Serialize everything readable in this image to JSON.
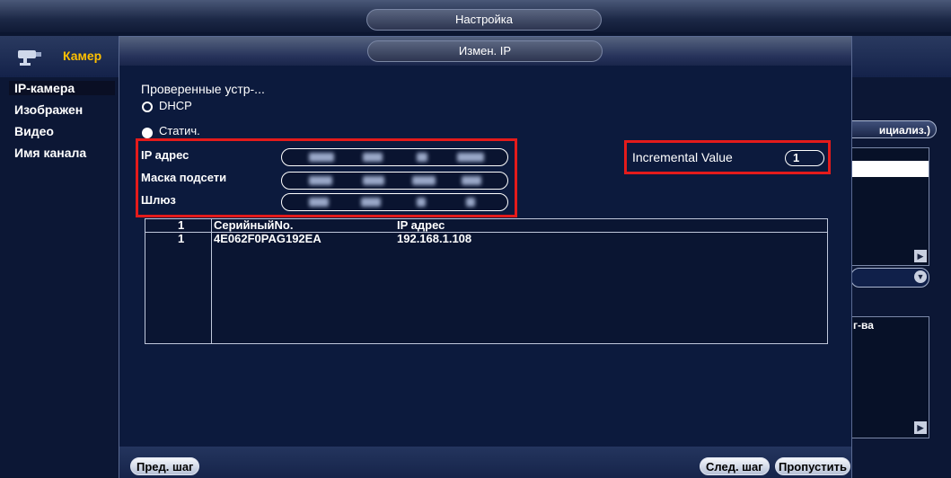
{
  "background": {
    "window_title": "Настройка",
    "header_title": "Камер",
    "sidebar": {
      "items": [
        {
          "label": "IP-камера",
          "active": true
        },
        {
          "label": "Изображен"
        },
        {
          "label": "Видео"
        },
        {
          "label": "Имя канала"
        }
      ]
    },
    "right_button_label": "ициализ.)",
    "right_box_label": "г-ва"
  },
  "dialog": {
    "title": "Измен. IP",
    "device_label": "Проверенные устр-...",
    "modes": [
      {
        "label": "DHCP",
        "selected": false
      },
      {
        "label": "Статич.",
        "selected": true
      }
    ],
    "fields": {
      "ip_label": "IP адрес",
      "mask_label": "Маска подсети",
      "gateway_label": "Шлюз"
    },
    "incremental": {
      "label": "Incremental Value",
      "value": "1"
    },
    "table": {
      "columns": [
        "1",
        "СерийныйNo.",
        "IP адрес"
      ],
      "rows": [
        {
          "num": "1",
          "serial": "4E062F0PAG192EA",
          "ip": "192.168.1.108"
        }
      ]
    },
    "footer": {
      "prev_label": "Пред. шаг",
      "next_label": "След. шаг",
      "skip_label": "Пропустить"
    }
  },
  "colors": {
    "highlight": "#e41b1b",
    "accent_title": "#ffc000"
  }
}
